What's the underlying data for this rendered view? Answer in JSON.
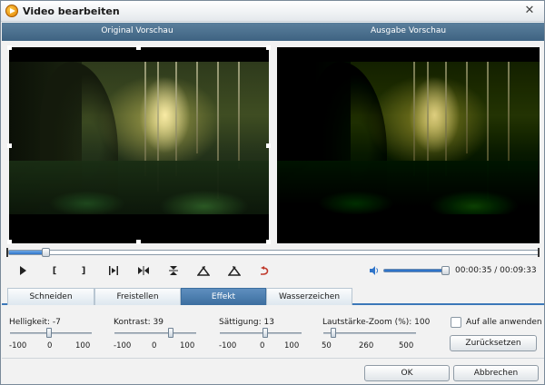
{
  "window": {
    "title": "Video bearbeiten",
    "close_glyph": "✕"
  },
  "preview": {
    "original_label": "Original Vorschau",
    "output_label": "Ausgabe Vorschau"
  },
  "timeline": {
    "progress": 0.068
  },
  "controls": {
    "items": [
      "play-icon",
      "mark-in-icon",
      "mark-out-icon",
      "clip-play-icon",
      "split-icon",
      "flip-vertical-icon",
      "rotate-left-icon",
      "rotate-right-icon",
      "undo-icon"
    ],
    "mark_in_glyph": "[",
    "mark_out_glyph": "]",
    "volume_level": 1.0,
    "time": "00:00:35 / 00:09:33"
  },
  "tabs": [
    {
      "label": "Schneiden",
      "active": false
    },
    {
      "label": "Freistellen",
      "active": false
    },
    {
      "label": "Effekt",
      "active": true
    },
    {
      "label": "Wasserzeichen",
      "active": false
    }
  ],
  "effects": {
    "brightness": {
      "label": "Helligkeit: -7",
      "min": "-100",
      "mid": "0",
      "max": "100",
      "value": -7
    },
    "contrast": {
      "label": "Kontrast: 39",
      "min": "-100",
      "mid": "0",
      "max": "100",
      "value": 39
    },
    "saturation": {
      "label": "Sättigung: 13",
      "min": "-100",
      "mid": "0",
      "max": "100",
      "value": 13
    },
    "volume_zoom": {
      "label": "Lautstärke-Zoom (%): 100",
      "min": "50",
      "mid": "260",
      "max": "500",
      "value": 100
    }
  },
  "apply_all_label": "Auf alle anwenden",
  "reset_label": "Zurücksetzen",
  "ok_label": "OK",
  "cancel_label": "Abbrechen",
  "colors": {
    "accent": "#3c78b9",
    "header": "#4a6f8f"
  }
}
